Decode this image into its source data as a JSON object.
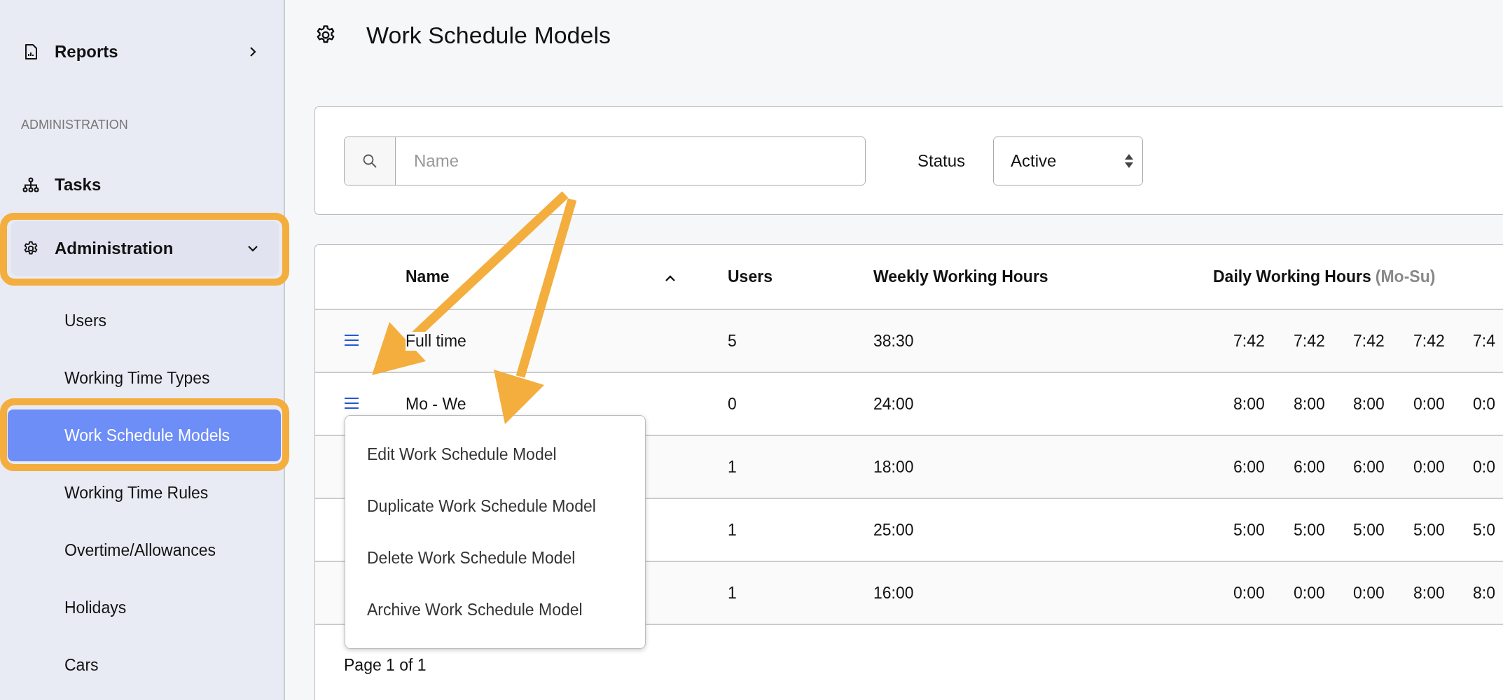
{
  "sidebar": {
    "items": [
      {
        "kind": "item",
        "label": "Reports",
        "expanded": false,
        "highlighted": false
      },
      {
        "kind": "section",
        "label": "ADMINISTRATION"
      },
      {
        "kind": "item",
        "label": "Tasks",
        "highlighted": false
      },
      {
        "kind": "item",
        "label": "Administration",
        "expanded": true,
        "highlighted": true,
        "children": [
          {
            "label": "Users",
            "selected": false,
            "highlighted": false
          },
          {
            "label": "Working Time Types",
            "selected": false,
            "highlighted": false
          },
          {
            "label": "Work Schedule Models",
            "selected": true,
            "highlighted": true
          },
          {
            "label": "Working Time Rules",
            "selected": false,
            "highlighted": false
          },
          {
            "label": "Overtime/Allowances",
            "selected": false,
            "highlighted": false
          },
          {
            "label": "Holidays",
            "selected": false,
            "highlighted": false
          },
          {
            "label": "Cars",
            "selected": false,
            "highlighted": false
          }
        ]
      }
    ]
  },
  "page": {
    "title": "Work Schedule Models"
  },
  "filters": {
    "search": {
      "placeholder": "Name"
    },
    "status": {
      "label": "Status",
      "value": "Active"
    }
  },
  "table": {
    "columns": [
      {
        "label": "Name",
        "sorted": true
      },
      {
        "label": "Users"
      },
      {
        "label": "Weekly Working Hours"
      },
      {
        "label": "Daily Working Hours",
        "hint": "(Mo-Su)"
      }
    ],
    "rows": [
      {
        "menu_icon": true,
        "name": "Full time",
        "users": "5",
        "weekly": "38:30",
        "daily": [
          "7:42",
          "7:42",
          "7:42",
          "7:42",
          "7:4"
        ]
      },
      {
        "menu_icon": true,
        "name": "Mo - We",
        "users": "0",
        "weekly": "24:00",
        "daily": [
          "8:00",
          "8:00",
          "8:00",
          "0:00",
          "0:0"
        ]
      },
      {
        "menu_icon": false,
        "users": "1",
        "weekly": "18:00",
        "daily": [
          "6:00",
          "6:00",
          "6:00",
          "0:00",
          "0:0"
        ]
      },
      {
        "menu_icon": false,
        "users": "1",
        "weekly": "25:00",
        "daily": [
          "5:00",
          "5:00",
          "5:00",
          "5:00",
          "5:0"
        ]
      },
      {
        "menu_icon": false,
        "users": "1",
        "weekly": "16:00",
        "daily": [
          "0:00",
          "0:00",
          "0:00",
          "8:00",
          "8:0"
        ]
      }
    ],
    "pagination": "Page 1 of 1"
  },
  "context_menu": {
    "items": [
      "Edit Work Schedule Model",
      "Duplicate Work Schedule Model",
      "Delete Work Schedule Model",
      "Archive Work Schedule Model"
    ]
  }
}
